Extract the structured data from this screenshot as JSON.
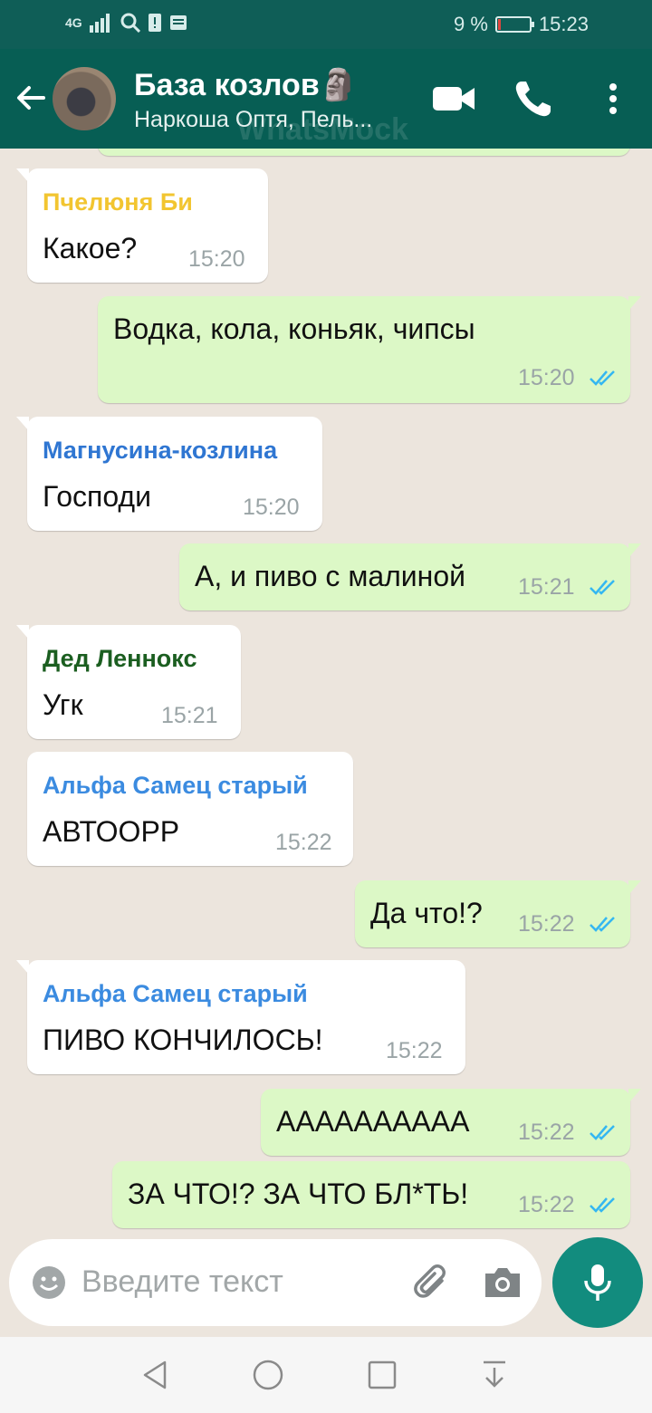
{
  "status_bar": {
    "signal": "4G",
    "battery": "9 %",
    "battery_level": 0.09,
    "time": "15:23"
  },
  "header": {
    "title": "База козлов🗿",
    "subtitle": "Наркоша Оптя, Пель...",
    "watermark": "WhatsMock"
  },
  "messages": [
    {
      "dir": "in",
      "sender": "Пчелюня Би",
      "sender_color": "#f2c530",
      "text": "Какое?",
      "time": "15:20"
    },
    {
      "dir": "out",
      "text": "Водка, кола, коньяк, чипсы",
      "time": "15:20",
      "read": true
    },
    {
      "dir": "in",
      "sender": "Магнусина-козлина",
      "sender_color": "#2f76d2",
      "text": "Господи",
      "time": "15:20"
    },
    {
      "dir": "out",
      "text": "А, и пиво с малиной",
      "time": "15:21",
      "read": true
    },
    {
      "dir": "in",
      "sender": "Дед Леннокс",
      "sender_color": "#1b5e20",
      "text": "Угк",
      "time": "15:21"
    },
    {
      "dir": "in",
      "sender": "Альфа Самец старый",
      "sender_color": "#3b8be0",
      "text": "АВТООРР",
      "time": "15:22"
    },
    {
      "dir": "out",
      "text": "Да что!?",
      "time": "15:22",
      "read": true
    },
    {
      "dir": "in",
      "sender": "Альфа Самец старый",
      "sender_color": "#3b8be0",
      "text": "ПИВО КОНЧИЛОСЬ!",
      "time": "15:22"
    },
    {
      "dir": "out",
      "text": "АААААААААА",
      "time": "15:22",
      "read": true
    },
    {
      "dir": "out",
      "text": "ЗА ЧТО!? ЗА ЧТО БЛ*ТЬ!",
      "time": "15:22",
      "read": true
    }
  ],
  "input": {
    "placeholder": "Введите текст"
  },
  "colors": {
    "header": "#075e54",
    "incoming": "#ffffff",
    "outgoing": "#dcf8c6",
    "read_ticks": "#34b7f1",
    "fab": "#128c7e"
  }
}
